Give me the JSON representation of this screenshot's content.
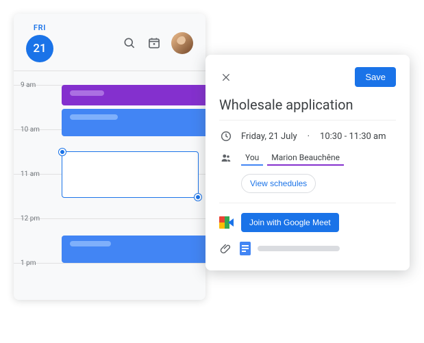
{
  "calendar": {
    "day_label": "FRI",
    "day_number": "21",
    "hours": [
      "9 am",
      "10 am",
      "11 am",
      "12 pm",
      "1 pm"
    ]
  },
  "detail": {
    "save_label": "Save",
    "title": "Wholesale application",
    "date_text": "Friday, 21 July",
    "time_text": "10:30 - 11:30 am",
    "guests": {
      "you": "You",
      "marion": "Marion Beauchêne"
    },
    "view_schedules_label": "View schedules",
    "meet_label": "Join with Google Meet"
  },
  "colors": {
    "accent": "#1a73e8",
    "purple": "#8430ce",
    "blue": "#4285f4"
  }
}
